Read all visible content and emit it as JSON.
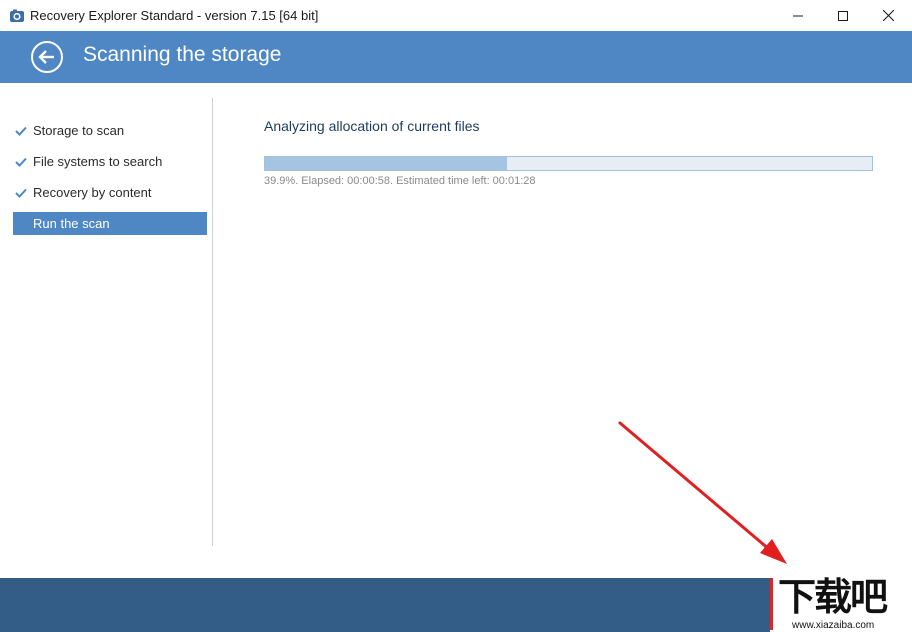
{
  "window": {
    "title": "Recovery Explorer Standard - version 7.15 [64 bit]",
    "app_icon": "recovery-explorer-icon",
    "controls": [
      "minimize-icon",
      "maximize-icon",
      "close-icon"
    ]
  },
  "header": {
    "title": "Scanning the storage",
    "back_icon": "back-arrow-icon",
    "background_color": "#4e87c4"
  },
  "sidebar": {
    "items": [
      {
        "label": "Storage to scan",
        "state": "done",
        "icon": "checkmark-icon"
      },
      {
        "label": "File systems to search",
        "state": "done",
        "icon": "checkmark-icon"
      },
      {
        "label": "Recovery by content",
        "state": "done",
        "icon": "checkmark-icon"
      },
      {
        "label": "Run the scan",
        "state": "active"
      }
    ]
  },
  "main": {
    "status_label": "Analyzing allocation of current files",
    "progress": {
      "percent": 39.9,
      "text": "39.9%. Elapsed: 00:00:58. Estimated time left: 00:01:28"
    }
  },
  "footer": {
    "background_color": "#335d86"
  },
  "overlay": {
    "arrow_icon": "red-arrow-annotation",
    "arrow_color": "#e02020"
  },
  "watermark": {
    "logo_text": "下载吧",
    "url": "www.xiazaiba.com"
  }
}
